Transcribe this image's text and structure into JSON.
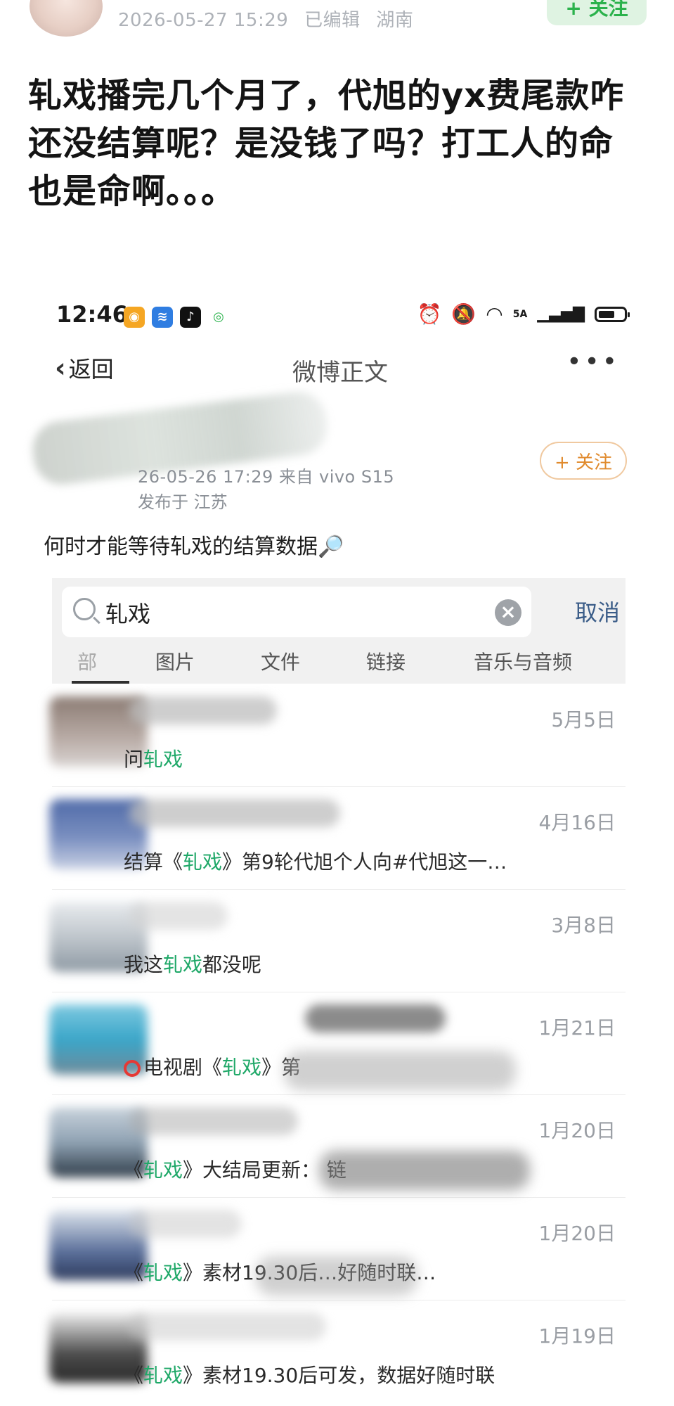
{
  "post": {
    "timestamp": "2026-05-27 15:29",
    "edited": "已编辑",
    "location": "湖南",
    "follow_label": "+ 关注",
    "text": "轧戏播完几个月了，代旭的yx费尾款咋还没结算呢？是没钱了吗？打工人的命也是命啊。。。"
  },
  "screenshot": {
    "status_bar": {
      "time": "12:46",
      "network": "5A"
    },
    "nav": {
      "back_label": "返回",
      "title": "微博正文",
      "more": "•••"
    },
    "author": {
      "time_source": "26-05-26 17:29  来自 vivo S15",
      "published_in": "发布于 江苏",
      "follow_label": "+ 关注"
    },
    "weibo_text": "何时才能等待轧戏的结算数据🔎",
    "chat_search": {
      "query": "轧戏",
      "cancel_label": "取消",
      "tabs": [
        "部",
        "图片",
        "文件",
        "链接",
        "音乐与音频"
      ]
    },
    "results": [
      {
        "date": "5月5日",
        "pre": "问",
        "kw": "轧戏",
        "post": ""
      },
      {
        "date": "4月16日",
        "pre": "结算《",
        "kw": "轧戏",
        "post": "》第9轮代旭个人向#代旭这一…"
      },
      {
        "date": "3月8日",
        "pre": "我这",
        "kw": "轧戏",
        "post": "都没呢"
      },
      {
        "date": "1月21日",
        "pre": "电视剧《",
        "kw": "轧戏",
        "post": "》第"
      },
      {
        "date": "1月20日",
        "pre": "《",
        "kw": "轧戏",
        "post": "》大结局更新：  链"
      },
      {
        "date": "1月20日",
        "pre": "《",
        "kw": "轧戏",
        "post": "》素材19.30后…好随时联…"
      },
      {
        "date": "1月19日",
        "pre": "《",
        "kw": "轧戏",
        "post": "》素材19.30后可发，数据好随时联"
      }
    ],
    "colors": {
      "keyword": "#1fa868",
      "follow_orange": "#e08a2c",
      "follow_green": "#2bb24c"
    }
  }
}
